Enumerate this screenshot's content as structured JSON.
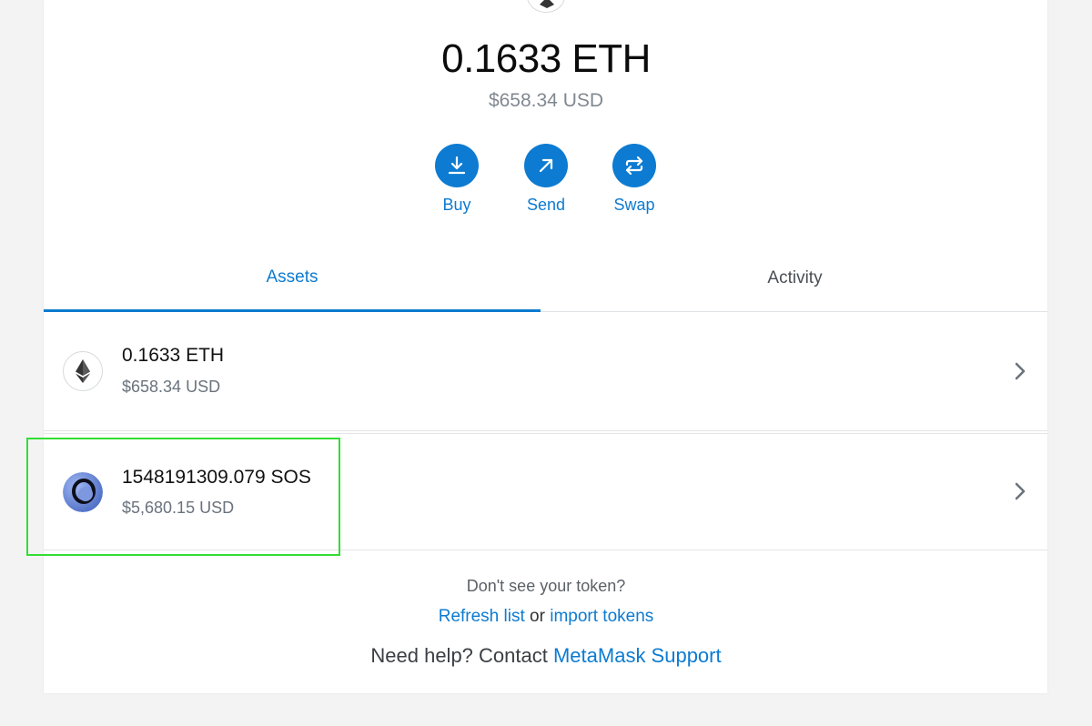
{
  "balance": {
    "amount": "0.1633 ETH",
    "fiat": "$658.34 USD"
  },
  "actions": [
    {
      "label": "Buy",
      "icon": "download-icon"
    },
    {
      "label": "Send",
      "icon": "arrow-up-right-icon"
    },
    {
      "label": "Swap",
      "icon": "swap-icon"
    }
  ],
  "tabs": {
    "assets": "Assets",
    "activity": "Activity",
    "active": "Assets"
  },
  "assets": [
    {
      "amount": "0.1633 ETH",
      "fiat": "$658.34 USD",
      "icon": "ethereum-icon"
    },
    {
      "amount": "1548191309.079 SOS",
      "fiat": "$5,680.15 USD",
      "icon": "sos-token-icon"
    }
  ],
  "footer": {
    "question": "Don't see your token?",
    "refresh": "Refresh list",
    "or": "or",
    "import": "import tokens",
    "help_prefix": "Need help? Contact",
    "support": "MetaMask Support"
  },
  "colors": {
    "accent": "#0d7bd1",
    "highlight": "#33dd33"
  }
}
